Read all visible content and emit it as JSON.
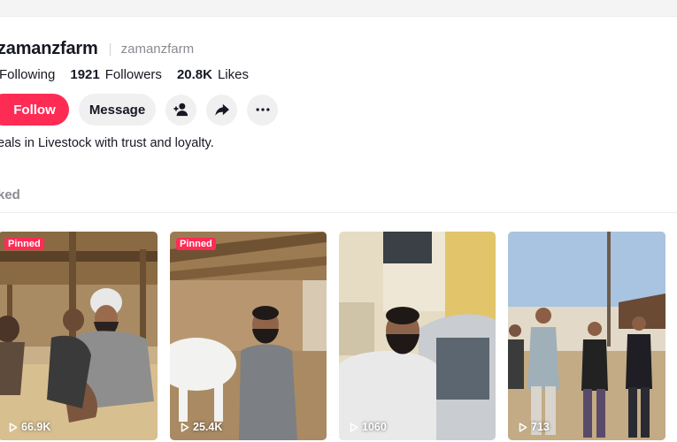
{
  "profile": {
    "display_name": "zamanzfarm",
    "username": "zamanzfarm",
    "bio": "eals in Livestock with trust and loyalty."
  },
  "stats": [
    {
      "value": "",
      "label": "Following"
    },
    {
      "value": "1921",
      "label": "Followers"
    },
    {
      "value": "20.8K",
      "label": "Likes"
    }
  ],
  "actions": {
    "follow_label": "Follow",
    "message_label": "Message",
    "add_friend_icon": "add-user-icon",
    "share_icon": "share-arrow-icon",
    "more_icon": "more-dots-icon"
  },
  "tabs": {
    "partial_label": "ked"
  },
  "videos": [
    {
      "badge": "Pinned",
      "views": "66.9K"
    },
    {
      "badge": "Pinned",
      "views": "25.4K"
    },
    {
      "badge": "",
      "views": "1060"
    },
    {
      "badge": "",
      "views": "713"
    }
  ],
  "colors": {
    "accent": "#fe2c55",
    "button_bg": "#f0f0f1",
    "text_primary": "#161823",
    "text_secondary": "#8a8b91"
  }
}
